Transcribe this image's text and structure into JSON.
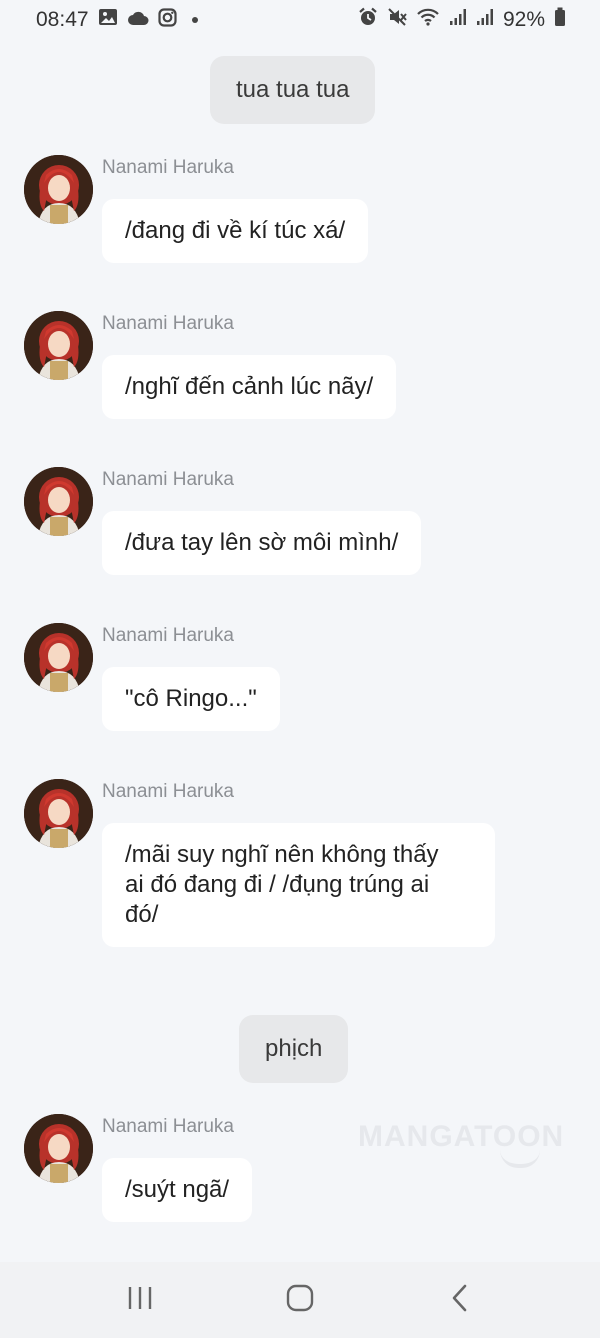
{
  "status_bar": {
    "time": "08:47",
    "battery": "92%",
    "left_icons": [
      "gallery-icon",
      "cloud-icon",
      "instagram-icon",
      "notification-dot-icon"
    ],
    "right_icons": [
      "alarm-icon",
      "mute-icon",
      "wifi-icon",
      "signal-icon",
      "signal-icon",
      "battery-icon"
    ]
  },
  "chat": {
    "items": [
      {
        "type": "narration",
        "text": "tua tua tua"
      },
      {
        "type": "message",
        "sender": "Nanami Haruka",
        "text": "/đang đi về kí túc xá/"
      },
      {
        "type": "message",
        "sender": "Nanami Haruka",
        "text": "/nghĩ đến cảnh lúc nãy/"
      },
      {
        "type": "message",
        "sender": "Nanami Haruka",
        "text": "/đưa tay lên sờ môi mình/"
      },
      {
        "type": "message",
        "sender": "Nanami Haruka",
        "text": "\"cô Ringo...\""
      },
      {
        "type": "message",
        "sender": "Nanami Haruka",
        "text": "/mãi suy nghĩ nên không thấy\nai đó đang đi / /đụng trúng ai\nđó/"
      },
      {
        "type": "narration",
        "text": "phịch"
      },
      {
        "type": "message",
        "sender": "Nanami Haruka",
        "text": "/suýt ngã/"
      }
    ]
  },
  "watermark": "MANGATOON",
  "nav_bar": {
    "buttons": [
      "recent-apps-icon",
      "home-icon",
      "back-icon"
    ]
  }
}
